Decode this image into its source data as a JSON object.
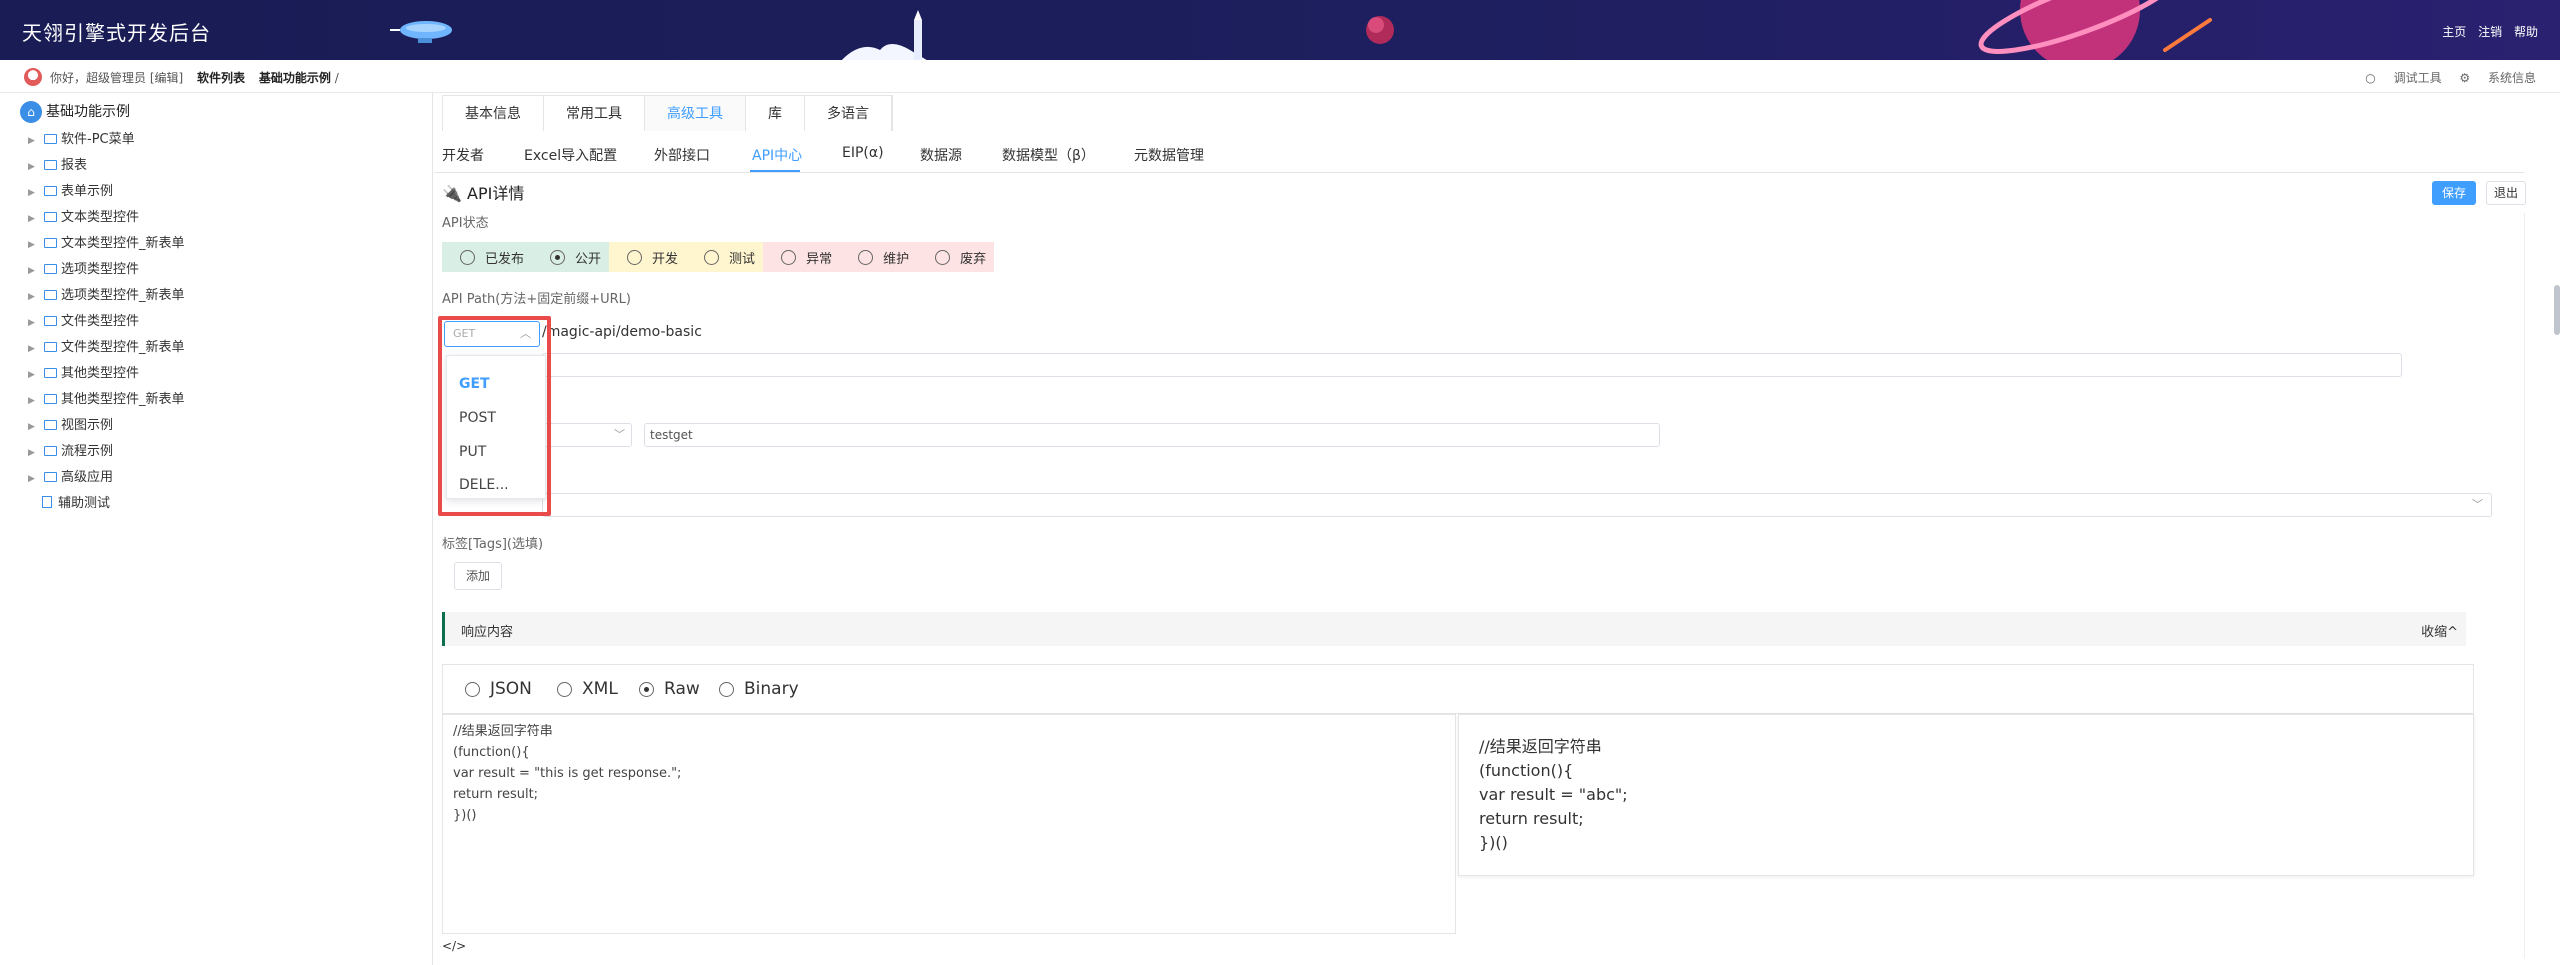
{
  "header": {
    "title": "天翎引擎式开发后台",
    "links": [
      "主页",
      "注销",
      "帮助"
    ]
  },
  "breadcrumb": {
    "greeting": "你好，超级管理员 [编辑]",
    "items": [
      "软件列表",
      "基础功能示例",
      "/"
    ],
    "right": [
      "调试工具",
      "系统信息"
    ]
  },
  "sidebar": {
    "root": "基础功能示例",
    "items": [
      "软件-PC菜单",
      "报表",
      "表单示例",
      "文本类型控件",
      "文本类型控件_新表单",
      "选项类型控件",
      "选项类型控件_新表单",
      "文件类型控件",
      "文件类型控件_新表单",
      "其他类型控件",
      "其他类型控件_新表单",
      "视图示例",
      "流程示例",
      "高级应用",
      "辅助测试"
    ]
  },
  "tabs_primary": [
    "基本信息",
    "常用工具",
    "高级工具",
    "库",
    "多语言"
  ],
  "tabs_secondary": [
    "开发者",
    "Excel导入配置",
    "外部接口",
    "API中心",
    "EIP(α)",
    "数据源",
    "数据模型（β）",
    "元数据管理"
  ],
  "detail": {
    "title": "API详情",
    "save": "保存",
    "exit": "退出",
    "status_label": "API状态",
    "statuses": [
      "已发布",
      "公开",
      "开发",
      "测试",
      "异常",
      "维护",
      "废弃"
    ],
    "selected_status": "公开",
    "status_colors": [
      "#d9eee4",
      "#d9eee4",
      "#fff6cf",
      "#fff6cf",
      "#fde3e3",
      "#fde3e3",
      "#fde3e3"
    ],
    "path_label": "API Path(方法+固定前缀+URL)",
    "method_value": "GET",
    "path_value": "/magic-api/demo-basic",
    "param_value": "testget",
    "methods": [
      "GET",
      "POST",
      "PUT",
      "DELE..."
    ],
    "tags_label": "标签[Tags](选填)",
    "add_button": "添加"
  },
  "response": {
    "title": "响应内容",
    "collapse": "收缩^",
    "formats": [
      "JSON",
      "XML",
      "Raw",
      "Binary"
    ],
    "selected_format": "Raw",
    "code_left": "//结果返回字符串\n(function(){\nvar result = \"this is get response.\";\nreturn result;\n})()",
    "code_right": "//结果返回字符串\n(function(){\nvar result = \"abc\";\nreturn result;\n})()",
    "code_tag": "</>"
  }
}
